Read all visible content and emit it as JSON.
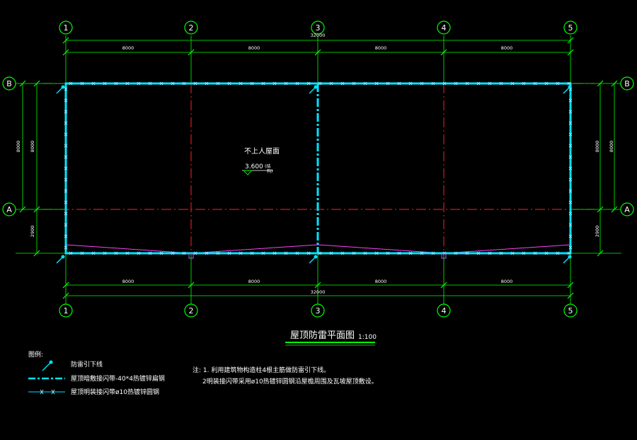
{
  "grid": {
    "columns": [
      "1",
      "2",
      "3",
      "4",
      "5"
    ],
    "rows": [
      "B",
      "A"
    ]
  },
  "dimensions": {
    "top_total": "32000",
    "bottom_total": "32000",
    "top_spans": [
      "8000",
      "8000",
      "8000",
      "8000"
    ],
    "bottom_spans": [
      "8000",
      "8000",
      "8000",
      "8000"
    ],
    "left_total": "8000",
    "left_upper": "8000",
    "left_lower": "2900",
    "right_total": "8000",
    "right_upper": "8000",
    "right_lower": "2900"
  },
  "roof": {
    "label": "不上人屋面",
    "elevation": "3.600",
    "elevation_note_1": "(结",
    "elevation_note_2": "构)"
  },
  "title": {
    "text": "屋顶防雷平面图",
    "scale": "1:100"
  },
  "legend": {
    "heading": "图例:",
    "items": [
      "防雷引下线",
      "屋顶暗敷接闪带-40*4热镀锌扁钢",
      "屋顶明装接闪带ø10热镀锌圆钢"
    ]
  },
  "notes": {
    "line1": "注: 1. 利用建筑物构造柱4根主筋做防雷引下线。",
    "line2": "2明装接闪带采用ø10热镀锌圆钢沿屋檐周围及瓦坡屋顶敷设。"
  },
  "colors": {
    "grid_axis": "#ff0000",
    "dimension": "#00ff00",
    "cyan": "#00ffff",
    "magenta": "#ff00ff",
    "text": "#ffffff",
    "bubble": "#00ff00"
  }
}
